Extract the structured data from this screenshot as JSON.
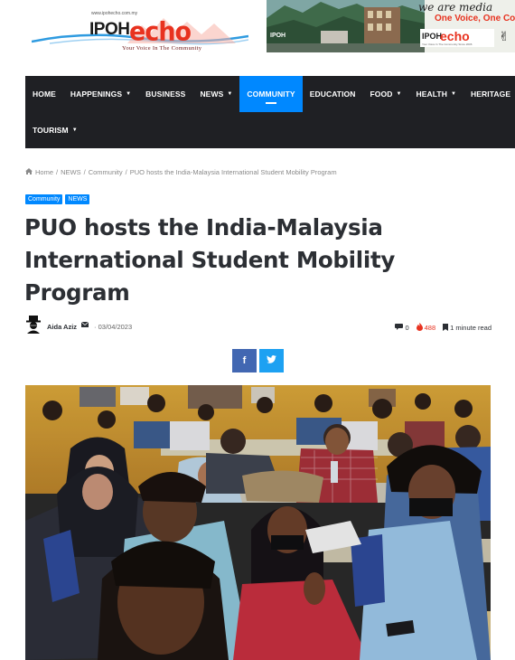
{
  "header": {
    "logo": {
      "url_text": "www.ipohecho.com.my",
      "ipoh": "IPOH",
      "echo": "echo",
      "tagline": "Your Voice In The Community"
    },
    "banner": {
      "place_label": "IPOH",
      "slogan_line1": "we are media",
      "slogan_line2": "One Voice, One Co",
      "mini_logo_ipoh": "IPOH",
      "mini_logo_echo": "echo",
      "mini_logo_tag": "Your Voice In The Community Since 2006"
    }
  },
  "nav": {
    "row1": [
      {
        "label": "HOME",
        "dropdown": false,
        "active": false
      },
      {
        "label": "HAPPENINGS",
        "dropdown": true,
        "active": false
      },
      {
        "label": "BUSINESS",
        "dropdown": false,
        "active": false
      },
      {
        "label": "NEWS",
        "dropdown": true,
        "active": false
      },
      {
        "label": "COMMUNITY",
        "dropdown": false,
        "active": true
      },
      {
        "label": "EDUCATION",
        "dropdown": false,
        "active": false
      },
      {
        "label": "FOOD",
        "dropdown": true,
        "active": false
      },
      {
        "label": "HEALTH",
        "dropdown": true,
        "active": false
      },
      {
        "label": "HERITAGE",
        "dropdown": true,
        "active": false
      }
    ],
    "row2": [
      {
        "label": "TOURISM",
        "dropdown": true,
        "active": false
      }
    ],
    "caret_glyph": "▼"
  },
  "breadcrumb": {
    "home": "Home",
    "items": [
      "NEWS",
      "Community",
      "PUO hosts the India-Malaysia International Student Mobility Program"
    ],
    "separator": "/"
  },
  "tags": [
    "Community",
    "NEWS"
  ],
  "article": {
    "title": "PUO hosts the India-Malaysia International Student Mobility Program",
    "author": "Aida Aziz",
    "date": "03/04/2023",
    "comments": "0",
    "views": "488",
    "read_time": "1 minute read"
  },
  "share": {
    "facebook": "f",
    "twitter": "t"
  },
  "colors": {
    "accent": "#0088ff",
    "nav_bg": "#1f2024",
    "brand_red": "#e8321f",
    "facebook": "#4267b2",
    "twitter": "#1da1f2"
  }
}
